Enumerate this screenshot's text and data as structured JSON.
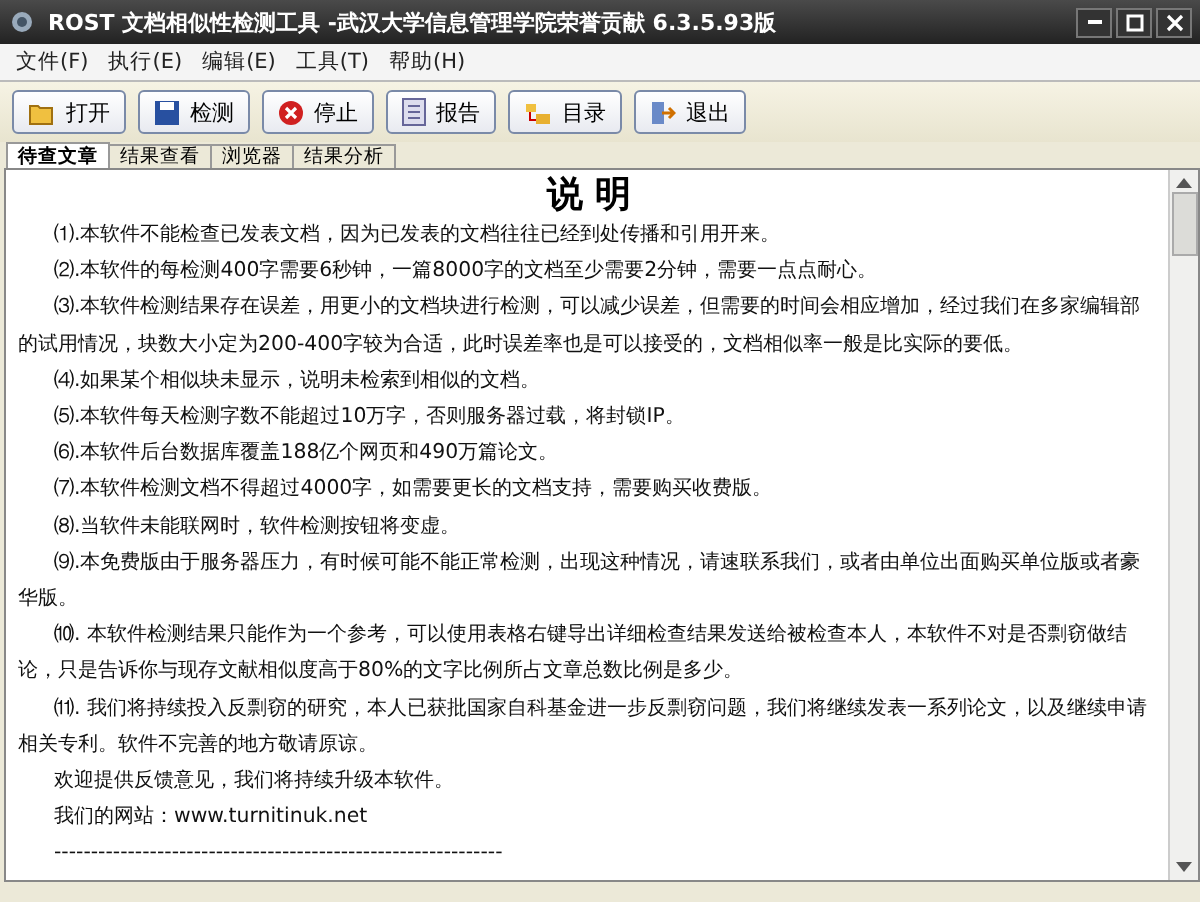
{
  "window": {
    "title": "ROST 文档相似性检测工具 -武汉大学信息管理学院荣誉贡献 6.3.5.93版"
  },
  "menu": [
    "文件(F)",
    "执行(E)",
    "编辑(E)",
    "工具(T)",
    "帮助(H)"
  ],
  "toolbar": [
    {
      "label": "打开",
      "kind": "open"
    },
    {
      "label": "检测",
      "kind": "save"
    },
    {
      "label": "停止",
      "kind": "stop"
    },
    {
      "label": "报告",
      "kind": "report"
    },
    {
      "label": "目录",
      "kind": "folder"
    },
    {
      "label": "退出",
      "kind": "exit"
    }
  ],
  "tabs": [
    {
      "label": "待查文章",
      "selected": true
    },
    {
      "label": "结果查看",
      "selected": false
    },
    {
      "label": "浏览器",
      "selected": false
    },
    {
      "label": "结果分析",
      "selected": false
    }
  ],
  "document": {
    "heading": "说 明",
    "paragraphs": [
      "⑴.本软件不能检查已发表文档，因为已发表的文档往往已经到处传播和引用开来。",
      "⑵.本软件的每检测400字需要6秒钟，一篇8000字的文档至少需要2分钟，需要一点点耐心。",
      "⑶.本软件检测结果存在误差，用更小的文档块进行检测，可以减少误差，但需要的时间会相应增加，经过我们在多家编辑部的试用情况，块数大小定为200-400字较为合适，此时误差率也是可以接受的，文档相似率一般是比实际的要低。",
      "⑷.如果某个相似块未显示，说明未检索到相似的文档。",
      "⑸.本软件每天检测字数不能超过10万字，否则服务器过载，将封锁IP。",
      "⑹.本软件后台数据库覆盖188亿个网页和490万篇论文。",
      "⑺.本软件检测文档不得超过4000字，如需要更长的文档支持，需要购买收费版。",
      "⑻.当软件未能联网时，软件检测按钮将变虚。",
      "⑼.本免费版由于服务器压力，有时候可能不能正常检测，出现这种情况，请速联系我们，或者由单位出面购买单位版或者豪华版。",
      "⑽. 本软件检测结果只能作为一个参考，可以使用表格右键导出详细检查结果发送给被检查本人，本软件不对是否剽窃做结论，只是告诉你与现存文献相似度高于80%的文字比例所占文章总数比例是多少。",
      "⑾. 我们将持续投入反剽窃的研究，本人已获批国家自科基金进一步反剽窃问题，我们将继续发表一系列论文，以及继续申请相关专利。软件不完善的地方敬请原谅。",
      "欢迎提供反馈意见，我们将持续升级本软件。",
      "我们的网站：www.turnitinuk.net",
      "-------------------------------------------------------------"
    ]
  }
}
